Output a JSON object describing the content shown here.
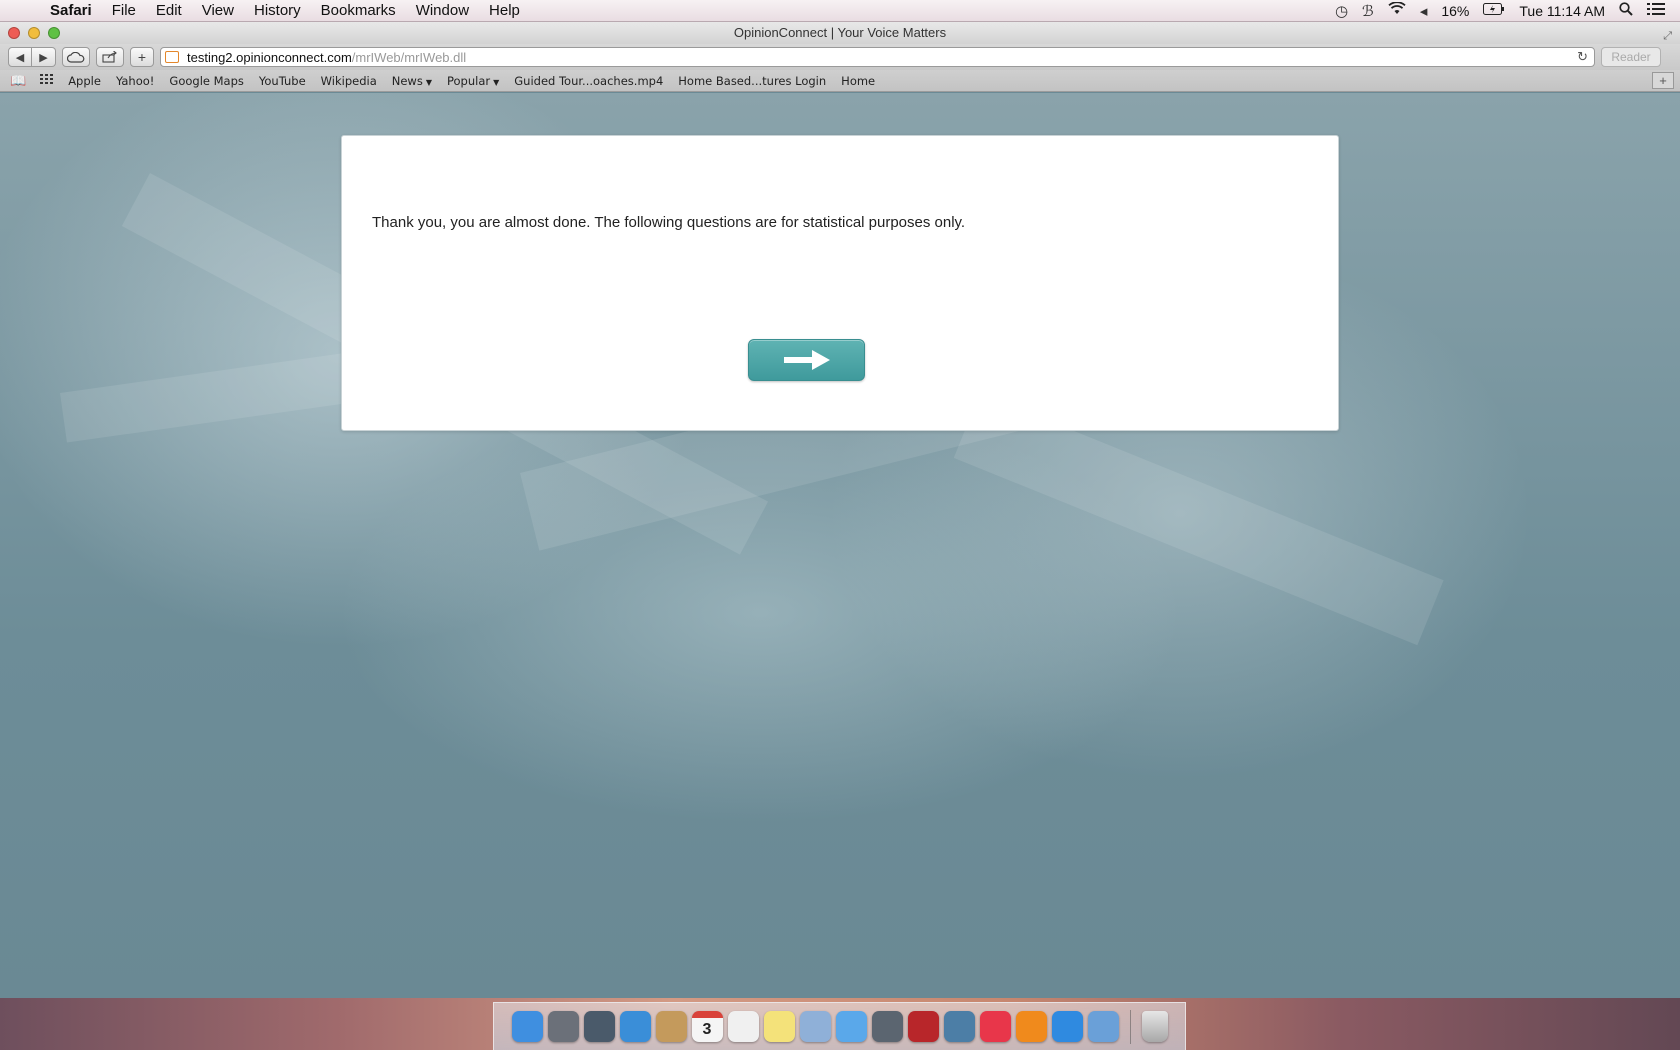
{
  "menubar": {
    "apple_glyph": "",
    "app_name": "Safari",
    "menus": [
      "File",
      "Edit",
      "View",
      "History",
      "Bookmarks",
      "Window",
      "Help"
    ],
    "battery": "16%",
    "clock": "Tue 11:14 AM",
    "status_icons": [
      "time-machine-icon",
      "bluetooth-icon",
      "wifi-icon",
      "volume-icon",
      "battery-icon",
      "spotlight-icon",
      "notification-center-icon"
    ]
  },
  "window": {
    "title": "OpinionConnect | Your Voice Matters"
  },
  "toolbar": {
    "url_domain": "testing2.opinionconnect.com",
    "url_path": "/mrIWeb/mrIWeb.dll",
    "reader_label": "Reader"
  },
  "bookmarks": {
    "items": [
      "Apple",
      "Yahoo!",
      "Google Maps",
      "YouTube",
      "Wikipedia",
      "News",
      "Popular",
      "Guided Tour...oaches.mp4",
      "Home Based...tures Login",
      "Home"
    ]
  },
  "survey": {
    "message": "Thank you, you are almost done. The following questions are for statistical purposes only.",
    "next_button_icon": "arrow-right-icon",
    "accent_color": "#4aa4a5"
  },
  "dock": {
    "apps": [
      {
        "name": "finder-icon",
        "color": "#3f8fe0"
      },
      {
        "name": "launchpad-icon",
        "color": "#6b7079"
      },
      {
        "name": "mission-control-icon",
        "color": "#4a5a6a"
      },
      {
        "name": "safari-icon",
        "color": "#3a8ed8"
      },
      {
        "name": "contacts-icon",
        "color": "#c49a5c"
      },
      {
        "name": "calendar-icon",
        "color": "#f5f5f5"
      },
      {
        "name": "reminders-icon",
        "color": "#f0f0f0"
      },
      {
        "name": "notes-icon",
        "color": "#f4e27a"
      },
      {
        "name": "preview-icon",
        "color": "#8fb0d8"
      },
      {
        "name": "messages-icon",
        "color": "#5aa8ea"
      },
      {
        "name": "facetime-icon",
        "color": "#5b6570"
      },
      {
        "name": "photo-booth-icon",
        "color": "#b8262a"
      },
      {
        "name": "iphoto-icon",
        "color": "#4c7ea6"
      },
      {
        "name": "itunes-icon",
        "color": "#e8364a"
      },
      {
        "name": "ibooks-icon",
        "color": "#f08a1c"
      },
      {
        "name": "app-store-icon",
        "color": "#2f8ae0"
      },
      {
        "name": "word-icon",
        "color": "#6aa0d8"
      }
    ],
    "calendar_day": "3",
    "trash_icon": "trash-icon"
  }
}
